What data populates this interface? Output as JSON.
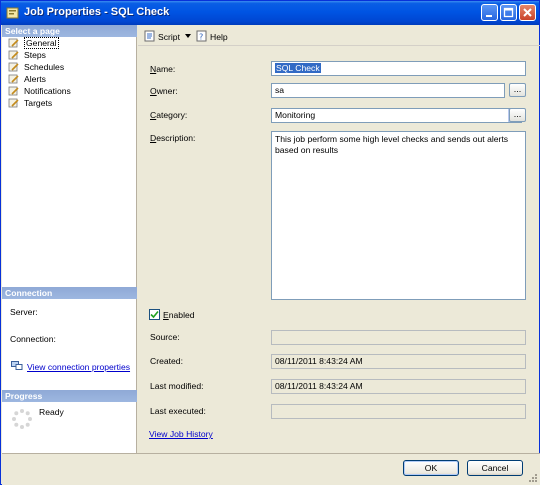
{
  "window": {
    "title": "Job Properties - SQL Check"
  },
  "left_pane": {
    "select_header": "Select a page",
    "pages": [
      {
        "label": "General",
        "selected": true
      },
      {
        "label": "Steps",
        "selected": false
      },
      {
        "label": "Schedules",
        "selected": false
      },
      {
        "label": "Alerts",
        "selected": false
      },
      {
        "label": "Notifications",
        "selected": false
      },
      {
        "label": "Targets",
        "selected": false
      }
    ],
    "connection_header": "Connection",
    "server_label": "Server:",
    "connection_label": "Connection:",
    "view_connection_link": "View connection properties",
    "progress_header": "Progress",
    "progress_status": "Ready"
  },
  "toolbar": {
    "script_label": "Script",
    "help_label": "Help"
  },
  "form": {
    "name_label": "Name:",
    "name_value": "SQL Check",
    "owner_label": "Owner:",
    "owner_value": "sa",
    "category_label": "Category:",
    "category_value": "Monitoring",
    "description_label": "Description:",
    "description_value": "This job perform some high level checks and sends out alerts based on results",
    "enabled_label": "Enabled",
    "enabled_checked": true,
    "source_label": "Source:",
    "source_value": "",
    "created_label": "Created:",
    "created_value": "08/11/2011 8:43:24 AM",
    "last_modified_label": "Last modified:",
    "last_modified_value": "08/11/2011 8:43:24 AM",
    "last_executed_label": "Last executed:",
    "last_executed_value": "",
    "view_history_link": "View Job History"
  },
  "buttons": {
    "ok_label": "OK",
    "cancel_label": "Cancel"
  },
  "colors": {
    "title_bar": "#0054e3",
    "dialog_bg": "#ece9d8",
    "pane_header": "#9db7e0",
    "link": "#0000cc",
    "selection": "#316ac5"
  }
}
